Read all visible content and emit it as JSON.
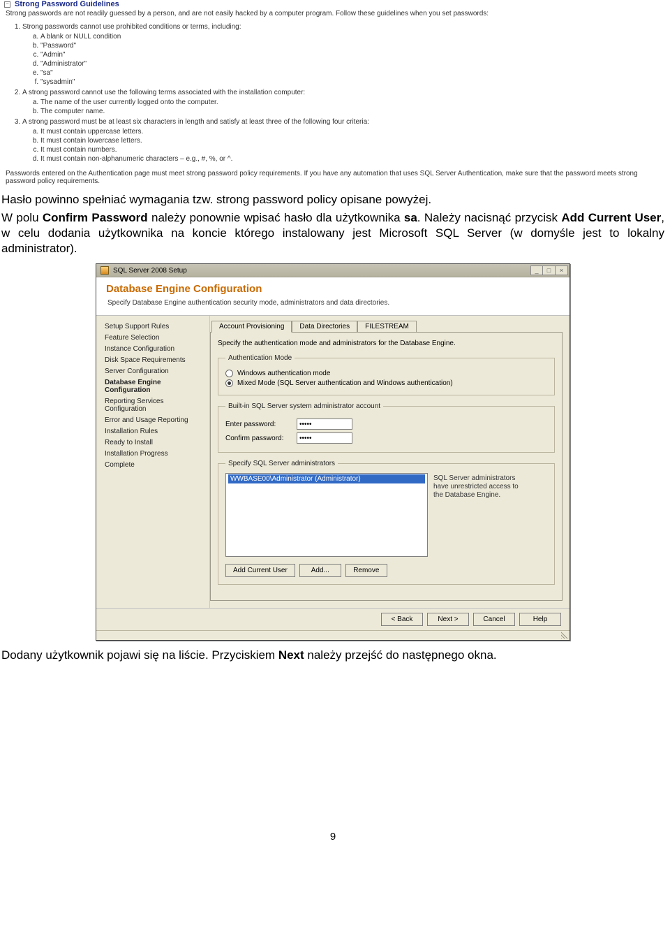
{
  "help": {
    "title": "Strong Password Guidelines",
    "intro": "Strong passwords are not readily guessed by a person, and are not easily hacked by a computer program. Follow these guidelines when you set passwords:",
    "items": [
      {
        "text": "Strong passwords cannot use prohibited conditions or terms, including:",
        "sub": [
          "A blank or NULL condition",
          "\"Password\"",
          "\"Admin\"",
          "\"Administrator\"",
          "\"sa\"",
          "\"sysadmin\""
        ]
      },
      {
        "text": "A strong password cannot use the following terms associated with the installation computer:",
        "sub": [
          "The name of the user currently logged onto the computer.",
          "The computer name."
        ]
      },
      {
        "text": "A strong password must be at least six characters in length and satisfy at least three of the following four criteria:",
        "sub": [
          "It must contain uppercase letters.",
          "It must contain lowercase letters.",
          "It must contain numbers.",
          "It must contain non-alphanumeric characters – e.g., #, %, or ^."
        ]
      }
    ],
    "outro": "Passwords entered on the Authentication page must meet strong password policy requirements. If you have any automation that uses SQL Server Authentication, make sure that the password meets strong password policy requirements."
  },
  "doc": {
    "p1": "Hasło powinno spełniać wymagania tzw. strong password policy opisane powyżej.",
    "p2_pre": "W polu ",
    "p2_b1": "Confirm Password",
    "p2_mid": " należy ponownie wpisać hasło dla użytkownika ",
    "p2_b2": "sa",
    "p2_post": ". Należy nacisnąć przycisk ",
    "p2_b3": "Add Current User",
    "p2_end": ", w celu dodania użytkownika na koncie którego instalowany jest Microsoft SQL Server (w domyśle jest to lokalny administrator).",
    "p3_pre": "Dodany użytkownik pojawi się na liście. Przyciskiem ",
    "p3_b": "Next",
    "p3_post": " należy przejść do następnego okna."
  },
  "wizard": {
    "title": "SQL Server 2008 Setup",
    "header": "Database Engine Configuration",
    "sub": "Specify Database Engine authentication security mode, administrators and data directories.",
    "steps": [
      "Setup Support Rules",
      "Feature Selection",
      "Instance Configuration",
      "Disk Space Requirements",
      "Server Configuration",
      "Database Engine Configuration",
      "Reporting Services Configuration",
      "Error and Usage Reporting",
      "Installation Rules",
      "Ready to Install",
      "Installation Progress",
      "Complete"
    ],
    "active_step": 5,
    "tabs": [
      "Account Provisioning",
      "Data Directories",
      "FILESTREAM"
    ],
    "panel_intro": "Specify the authentication mode and administrators for the Database Engine.",
    "auth_legend": "Authentication Mode",
    "auth_opt1": "Windows authentication mode",
    "auth_opt2": "Mixed Mode (SQL Server authentication and Windows authentication)",
    "sa_legend": "Built-in SQL Server system administrator account",
    "sa_enter": "Enter password:",
    "sa_confirm": "Confirm password:",
    "sa_value": "•••••",
    "admins_legend": "Specify SQL Server administrators",
    "admin_entry": "WWBASE00\\Administrator (Administrator)",
    "admins_hint": "SQL Server administrators have unrestricted access to the Database Engine.",
    "btn_add_current": "Add Current User",
    "btn_add": "Add...",
    "btn_remove": "Remove",
    "btn_back": "< Back",
    "btn_next": "Next >",
    "btn_cancel": "Cancel",
    "btn_help": "Help"
  },
  "page_number": "9"
}
